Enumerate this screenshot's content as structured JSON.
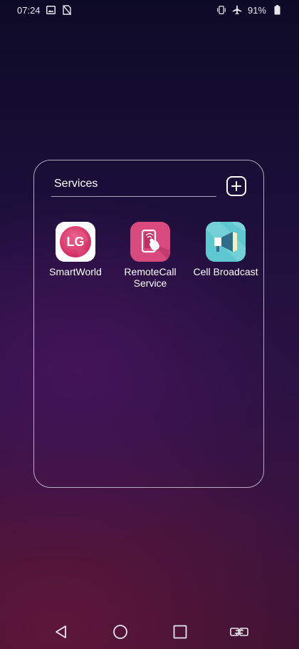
{
  "status_bar": {
    "time": "07:24",
    "battery": "91%",
    "left_icons": [
      "gallery-icon",
      "no-sim-icon"
    ],
    "right_icons": [
      "vibrate-icon",
      "airplane-icon",
      "battery-icon"
    ]
  },
  "folder": {
    "title": "Services",
    "add_icon": "plus-icon",
    "apps": [
      {
        "label_line1": "SmartWorld",
        "label_line2": "",
        "icon": "lg-smartworld-icon",
        "color": "#d63a6e",
        "logo_text": "LG"
      },
      {
        "label_line1": "RemoteCall",
        "label_line2": "Service",
        "icon": "remotecall-icon",
        "color": "#d84a7e"
      },
      {
        "label_line1": "Cell Broadcast",
        "label_line2": "",
        "icon": "cell-broadcast-icon",
        "color": "#5fc7cf"
      }
    ]
  },
  "nav_bar": {
    "icons": [
      "back-icon",
      "home-icon",
      "recents-icon",
      "dual-window-icon"
    ]
  },
  "colors": {
    "background_top": "#0d0a26",
    "background_bottom": "#3c1231",
    "folder_border": "#e6dcf0"
  }
}
